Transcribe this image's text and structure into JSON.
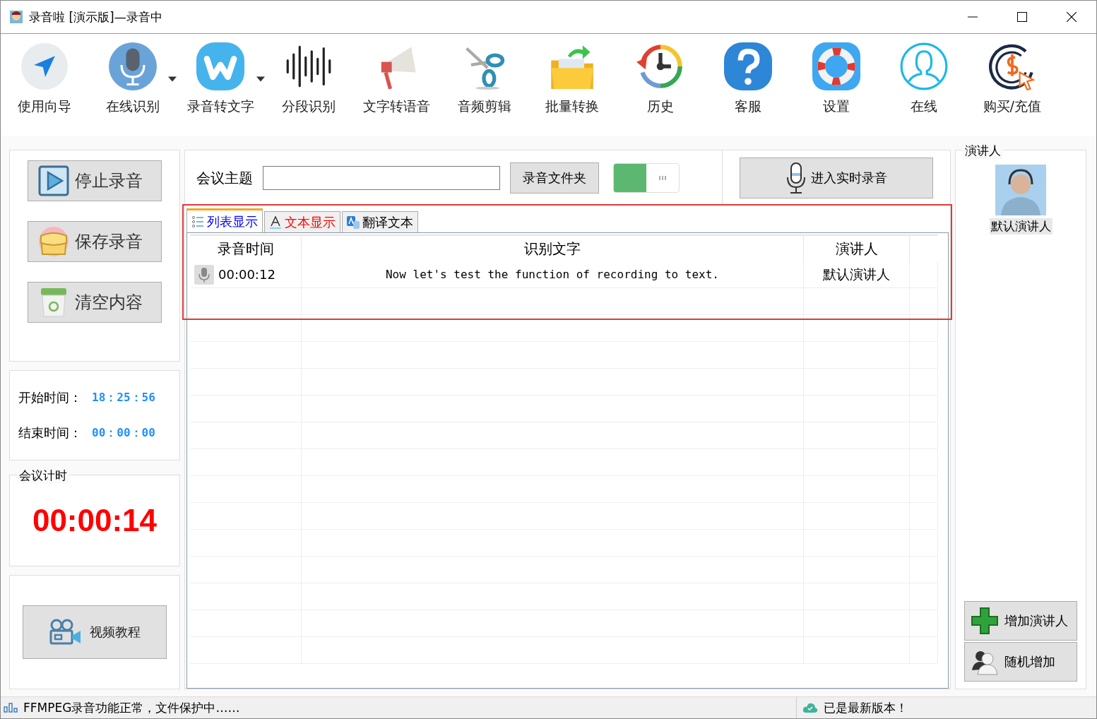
{
  "window": {
    "title": "录音啦 [演示版]—录音中"
  },
  "toolbar": [
    {
      "label": "使用向导",
      "kind": "guide",
      "dropdown": false
    },
    {
      "label": "在线识别",
      "kind": "mic",
      "dropdown": true
    },
    {
      "label": "录音转文字",
      "kind": "w",
      "dropdown": true
    },
    {
      "label": "分段识别",
      "kind": "wave",
      "dropdown": false
    },
    {
      "label": "文字转语音",
      "kind": "megaphone",
      "dropdown": false
    },
    {
      "label": "音频剪辑",
      "kind": "scissors",
      "dropdown": false
    },
    {
      "label": "批量转换",
      "kind": "folder",
      "dropdown": false
    },
    {
      "label": "历史",
      "kind": "history",
      "dropdown": false
    },
    {
      "label": "客服",
      "kind": "help",
      "dropdown": false
    },
    {
      "label": "设置",
      "kind": "lifebuoy",
      "dropdown": false
    },
    {
      "label": "在线",
      "kind": "user",
      "dropdown": false
    },
    {
      "label": "购买/充值",
      "kind": "buy",
      "dropdown": false
    }
  ],
  "controls": [
    {
      "label": "停止录音",
      "kind": "play"
    },
    {
      "label": "保存录音",
      "kind": "bag"
    },
    {
      "label": "清空内容",
      "kind": "bin"
    }
  ],
  "times": [
    {
      "label": "开始时间：",
      "value": "18：25：56"
    },
    {
      "label": "结束时间：",
      "value": "00：00：00"
    }
  ],
  "meeting_timer": {
    "title": "会议计时",
    "value": "00:00:14"
  },
  "tutorial_button": "视频教程",
  "topic": {
    "label": "会议主题"
  },
  "folder_button": "录音文件夹",
  "toggle": {
    "on": true
  },
  "realtime_button": "进入实时录音",
  "tabs": [
    {
      "label": "列表显示",
      "kind": "list",
      "selected": true,
      "color": "#0000ff"
    },
    {
      "label": "文本显示",
      "kind": "text",
      "selected": false,
      "color": "#ff0000"
    },
    {
      "label": "翻译文本",
      "kind": "translate",
      "selected": false,
      "color": "#000000"
    }
  ],
  "table": {
    "columns": [
      "录音时间",
      "识别文字",
      "演讲人"
    ],
    "rows": [
      {
        "time": "00:00:12",
        "text": "Now let's test the function of recording to text.",
        "speaker": "默认演讲人"
      }
    ]
  },
  "speakers": {
    "title": "演讲人",
    "items": [
      {
        "name": "默认演讲人"
      }
    ]
  },
  "speaker_buttons": [
    {
      "label": "增加演讲人",
      "kind": "add"
    },
    {
      "label": "随机增加",
      "kind": "random"
    }
  ],
  "status_bar": {
    "left": "FFMPEG录音功能正常，文件保护中……",
    "right": "已是最新版本！"
  }
}
